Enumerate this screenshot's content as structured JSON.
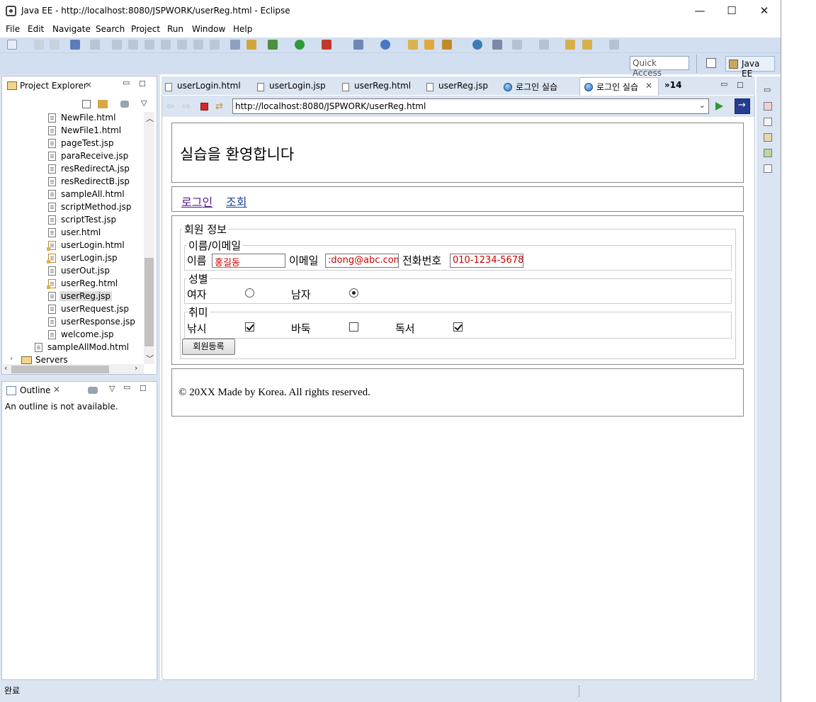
{
  "window": {
    "title": "Java EE - http://localhost:8080/JSPWORK/userReg.html - Eclipse",
    "minimize": "—",
    "maximize": "☐",
    "close": "✕"
  },
  "menu": [
    "File",
    "Edit",
    "Navigate",
    "Search",
    "Project",
    "Run",
    "Window",
    "Help"
  ],
  "quick_access": {
    "placeholder": "Quick Access"
  },
  "perspective": {
    "label": "Java EE"
  },
  "project_explorer": {
    "tab_label": "Project Explorer",
    "files": [
      {
        "name": "NewFile.html",
        "type": "html"
      },
      {
        "name": "NewFile1.html",
        "type": "html"
      },
      {
        "name": "pageTest.jsp",
        "type": "jsp"
      },
      {
        "name": "paraReceive.jsp",
        "type": "jsp"
      },
      {
        "name": "resRedirectA.jsp",
        "type": "jsp"
      },
      {
        "name": "resRedirectB.jsp",
        "type": "jsp"
      },
      {
        "name": "sampleAll.html",
        "type": "html"
      },
      {
        "name": "scriptMethod.jsp",
        "type": "jsp"
      },
      {
        "name": "scriptTest.jsp",
        "type": "jsp"
      },
      {
        "name": "user.html",
        "type": "html"
      },
      {
        "name": "userLogin.html",
        "type": "jsp-warning"
      },
      {
        "name": "userLogin.jsp",
        "type": "jsp-warning"
      },
      {
        "name": "userOut.jsp",
        "type": "jsp"
      },
      {
        "name": "userReg.html",
        "type": "jsp-warning"
      },
      {
        "name": "userReg.jsp",
        "type": "jsp",
        "selected": true
      },
      {
        "name": "userRequest.jsp",
        "type": "jsp"
      },
      {
        "name": "userResponse.jsp",
        "type": "jsp"
      },
      {
        "name": "welcome.jsp",
        "type": "jsp"
      },
      {
        "name": "sampleAllMod.html",
        "type": "html"
      },
      {
        "name": "Servers",
        "type": "folder"
      }
    ]
  },
  "outline": {
    "tab_label": "Outline",
    "message": "An outline is not available."
  },
  "editor_tabs": [
    {
      "label": "userLogin.html",
      "icon": "file-icon"
    },
    {
      "label": "userLogin.jsp",
      "icon": "file-icon"
    },
    {
      "label": "userReg.html",
      "icon": "file-icon"
    },
    {
      "label": "userReg.jsp",
      "icon": "file-icon"
    },
    {
      "label": "로그인 실습",
      "icon": "globe-icon"
    },
    {
      "label": "로그인 실습",
      "icon": "globe-icon",
      "active": true
    }
  ],
  "overflow_tabs": "»14",
  "browser": {
    "url": "http://localhost:8080/JSPWORK/userReg.html"
  },
  "page": {
    "heading": "실습을 환영합니다",
    "nav": [
      "로그인",
      "조회"
    ],
    "form": {
      "legend": "회원 정보",
      "name_email": {
        "legend": "이름/이메일",
        "name_label": "이름",
        "name_value": "홍길동",
        "email_label": "이메일",
        "email_value": ":dong@abc.com",
        "phone_label": "전화번호",
        "phone_value": "010-1234-5678"
      },
      "gender": {
        "legend": "성별",
        "female": "여자",
        "male": "남자",
        "selected": "남자"
      },
      "hobby": {
        "legend": "취미",
        "fishing": "낚시",
        "go": "바둑",
        "reading": "독서",
        "checked": [
          "낚시",
          "독서"
        ]
      },
      "submit": "회원등록"
    },
    "footer": "© 20XX Made by Korea. All rights reserved."
  },
  "status": {
    "text": "완료"
  }
}
